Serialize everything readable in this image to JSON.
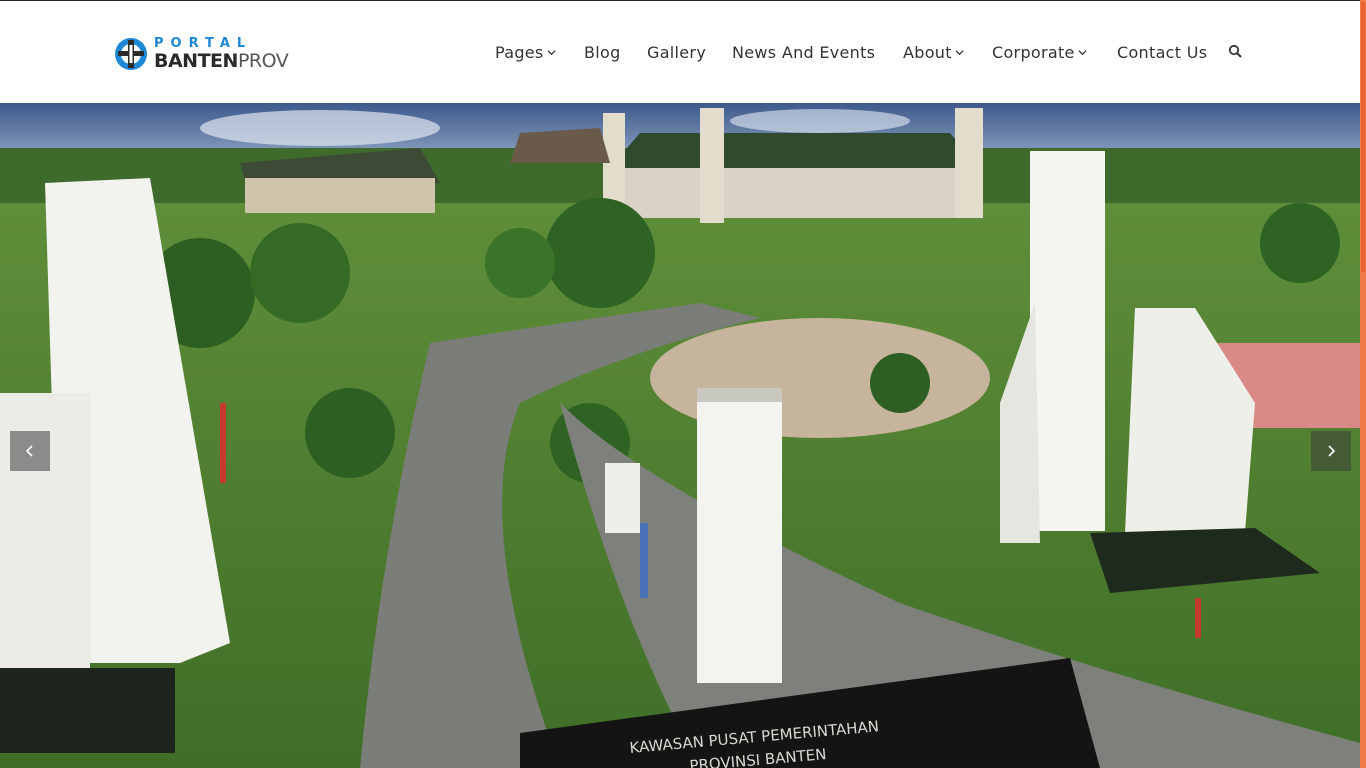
{
  "brand": {
    "logo_top": "PORTAL",
    "logo_bottom_bold": "BANTEN",
    "logo_bottom_light": "PROV",
    "accent": "#1e88d6"
  },
  "nav": {
    "items": [
      {
        "label": "Pages",
        "has_dropdown": true
      },
      {
        "label": "Blog",
        "has_dropdown": false
      },
      {
        "label": "Gallery",
        "has_dropdown": false
      },
      {
        "label": "News And Events",
        "has_dropdown": false
      },
      {
        "label": "About",
        "has_dropdown": true
      },
      {
        "label": "Corporate",
        "has_dropdown": true
      },
      {
        "label": "Contact Us",
        "has_dropdown": false
      }
    ],
    "search_icon": "search-icon"
  },
  "hero": {
    "sign_line1": "KAWASAN PUSAT PEMERINTAHAN",
    "sign_line2": "PROVINSI BANTEN",
    "prev_icon": "chevron-left-icon",
    "next_icon": "chevron-right-icon"
  },
  "colors": {
    "scrollbar": "#f07a4a",
    "nav_text": "#333333"
  }
}
